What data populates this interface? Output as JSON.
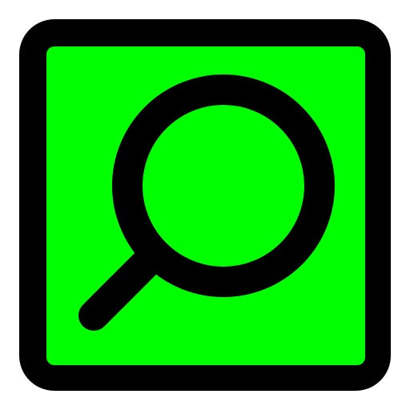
{
  "icon": {
    "name": "magnifying-glass-icon",
    "frame_color": "#000000",
    "fill_color": "#00ff00",
    "glyph_color": "#000000"
  }
}
